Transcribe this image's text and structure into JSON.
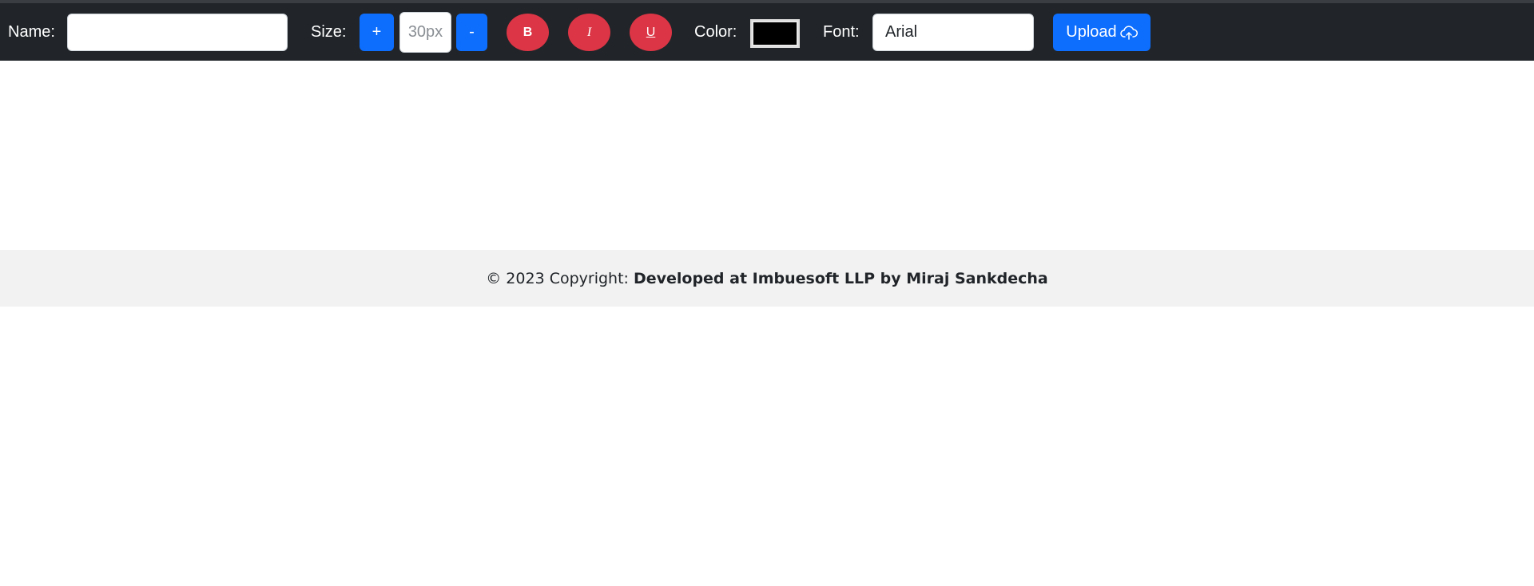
{
  "toolbar": {
    "name_label": "Name:",
    "name_value": "",
    "size_label": "Size:",
    "size_increase": "+",
    "size_placeholder": "30px",
    "size_decrease": "-",
    "bold_label": "B",
    "italic_label": "I",
    "underline_label": "U",
    "color_label": "Color:",
    "color_value": "#000000",
    "font_label": "Font:",
    "font_value": "Arial",
    "upload_label": "Upload"
  },
  "footer": {
    "prefix": "© 2023 Copyright:",
    "credit": "Developed at Imbuesoft LLP by Miraj Sankdecha"
  },
  "colors": {
    "toolbar_bg": "#212529",
    "primary": "#0d6efd",
    "danger": "#dc3545",
    "footer_bg": "#f2f2f2"
  }
}
